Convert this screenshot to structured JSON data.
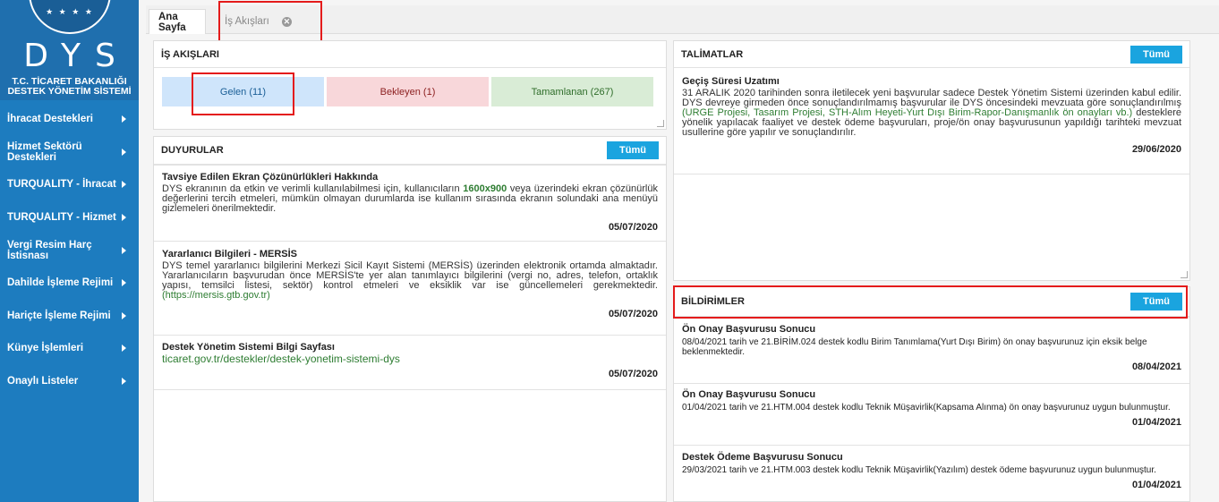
{
  "sidebar": {
    "logo_text": "DYS",
    "ministry_line1": "T.C. TİCARET BAKANLIĞI",
    "ministry_line2": "DESTEK YÖNETİM SİSTEMİ",
    "items": [
      {
        "label": "İhracat Destekleri"
      },
      {
        "label": "Hizmet Sektörü Destekleri"
      },
      {
        "label": "TURQUALITY - İhracat"
      },
      {
        "label": "TURQUALITY - Hizmet"
      },
      {
        "label": "Vergi Resim Harç İstisnası"
      },
      {
        "label": "Dahilde İşleme Rejimi"
      },
      {
        "label": "Hariçte İşleme Rejimi"
      },
      {
        "label": "Künye İşlemleri"
      },
      {
        "label": "Onaylı Listeler"
      }
    ]
  },
  "tabs": {
    "home": "Ana Sayfa",
    "flows": "İş Akışları"
  },
  "workflows": {
    "title": "İŞ AKIŞLARI",
    "incoming": "Gelen (11)",
    "pending": "Bekleyen (1)",
    "completed": "Tamamlanan (267)"
  },
  "announcements": {
    "title": "DUYURULAR",
    "all_button": "Tümü",
    "items": [
      {
        "title": "Tavsiye Edilen Ekran Çözünürlükleri Hakkında",
        "body_a": "DYS ekranının da etkin ve verimli kullanılabilmesi için, kullanıcıların ",
        "body_highlight": "1600x900",
        "body_b": " veya üzerindeki ekran çözünürlük değerlerini tercih etmeleri, mümkün olmayan durumlarda ise kullanım sırasında ekranın solundaki ana menüyü gizlemeleri önerilmektedir.",
        "date": "05/07/2020"
      },
      {
        "title": "Yararlanıcı Bilgileri - MERSİS",
        "body_a": "DYS temel yararlanıcı bilgilerini Merkezi Sicil Kayıt Sistemi (MERSİS) üzerinden elektronik ortamda almaktadır. Yararlanıcıların başvurudan önce MERSİS'te yer alan tanımlayıcı bilgilerini (vergi no, adres, telefon, ortaklık yapısı, temsilci listesi, sektör) kontrol etmeleri ve eksiklik var ise güncellemeleri gerekmektedir.",
        "link": "(https://mersis.gtb.gov.tr)",
        "date": "05/07/2020"
      },
      {
        "title": "Destek Yönetim Sistemi Bilgi Sayfası",
        "link": "ticaret.gov.tr/destekler/destek-yonetim-sistemi-dys",
        "date": "05/07/2020"
      }
    ]
  },
  "instructions": {
    "title": "TALİMATLAR",
    "all_button": "Tümü",
    "item": {
      "title": "Geçiş Süresi Uzatımı",
      "body_a": "31 ARALIK 2020 tarihinden sonra iletilecek yeni başvurular sadece Destek Yönetim Sistemi üzerinden kabul edilir. DYS devreye girmeden önce sonuçlandırılmamış başvurular ile DYS öncesindeki mevzuata göre sonuçlandırılmış ",
      "body_highlight": "(URGE Projesi, Tasarım Projesi, STH-Alım Heyeti-Yurt Dışı Birim-Rapor-Danışmanlık ön onayları vb.)",
      "body_b": " desteklere yönelik yapılacak faaliyet ve destek ödeme başvuruları, proje/ön onay başvurusunun yapıldığı tarihteki mevzuat usullerine göre yapılır ve sonuçlandırılır.",
      "date": "29/06/2020"
    }
  },
  "notifications": {
    "title": "BİLDİRİMLER",
    "all_button": "Tümü",
    "items": [
      {
        "title": "Ön Onay Başvurusu Sonucu",
        "body": "08/04/2021 tarih ve 21.BİRİM.024 destek kodlu Birim Tanımlama(Yurt Dışı Birim) ön onay başvurunuz için eksik belge beklenmektedir.",
        "date": "08/04/2021"
      },
      {
        "title": "Ön Onay Başvurusu Sonucu",
        "body": "01/04/2021 tarih ve 21.HTM.004 destek kodlu Teknik Müşavirlik(Kapsama Alınma) ön onay başvurunuz uygun bulunmuştur.",
        "date": "01/04/2021"
      },
      {
        "title": "Destek Ödeme Başvurusu Sonucu",
        "body": "29/03/2021 tarih ve 21.HTM.003 destek kodlu Teknik Müşavirlik(Yazılım) destek ödeme başvurunuz uygun bulunmuştur.",
        "date": "01/04/2021"
      }
    ]
  }
}
